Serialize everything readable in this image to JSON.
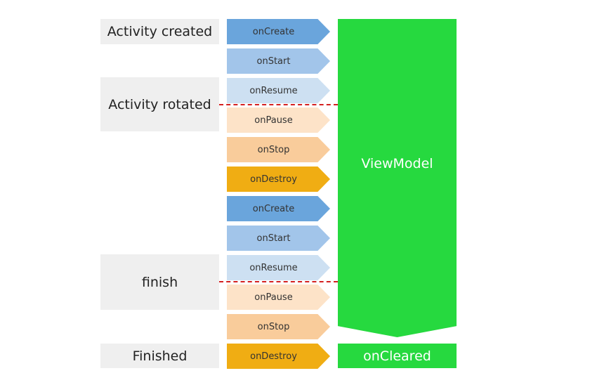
{
  "states": [
    {
      "label": "Activity created"
    },
    {
      "label": "Activity rotated"
    },
    {
      "label": "finish"
    },
    {
      "label": "Finished"
    }
  ],
  "lifecycle": [
    {
      "label": "onCreate",
      "color": "#6aa5dc"
    },
    {
      "label": "onStart",
      "color": "#a2c5ea"
    },
    {
      "label": "onResume",
      "color": "#cde0f2"
    },
    {
      "label": "onPause",
      "color": "#fde3c8"
    },
    {
      "label": "onStop",
      "color": "#f9cc9b"
    },
    {
      "label": "onDestroy",
      "color": "#f0ad13"
    },
    {
      "label": "onCreate",
      "color": "#6aa5dc"
    },
    {
      "label": "onStart",
      "color": "#a2c5ea"
    },
    {
      "label": "onResume",
      "color": "#cde0f2"
    },
    {
      "label": "onPause",
      "color": "#fde3c8"
    },
    {
      "label": "onStop",
      "color": "#f9cc9b"
    },
    {
      "label": "onDestroy",
      "color": "#f0ad13"
    }
  ],
  "viewmodel": {
    "label": "ViewModel",
    "color": "#26d93f"
  },
  "cleared": {
    "label": "onCleared"
  },
  "divider_color": "#d42020"
}
